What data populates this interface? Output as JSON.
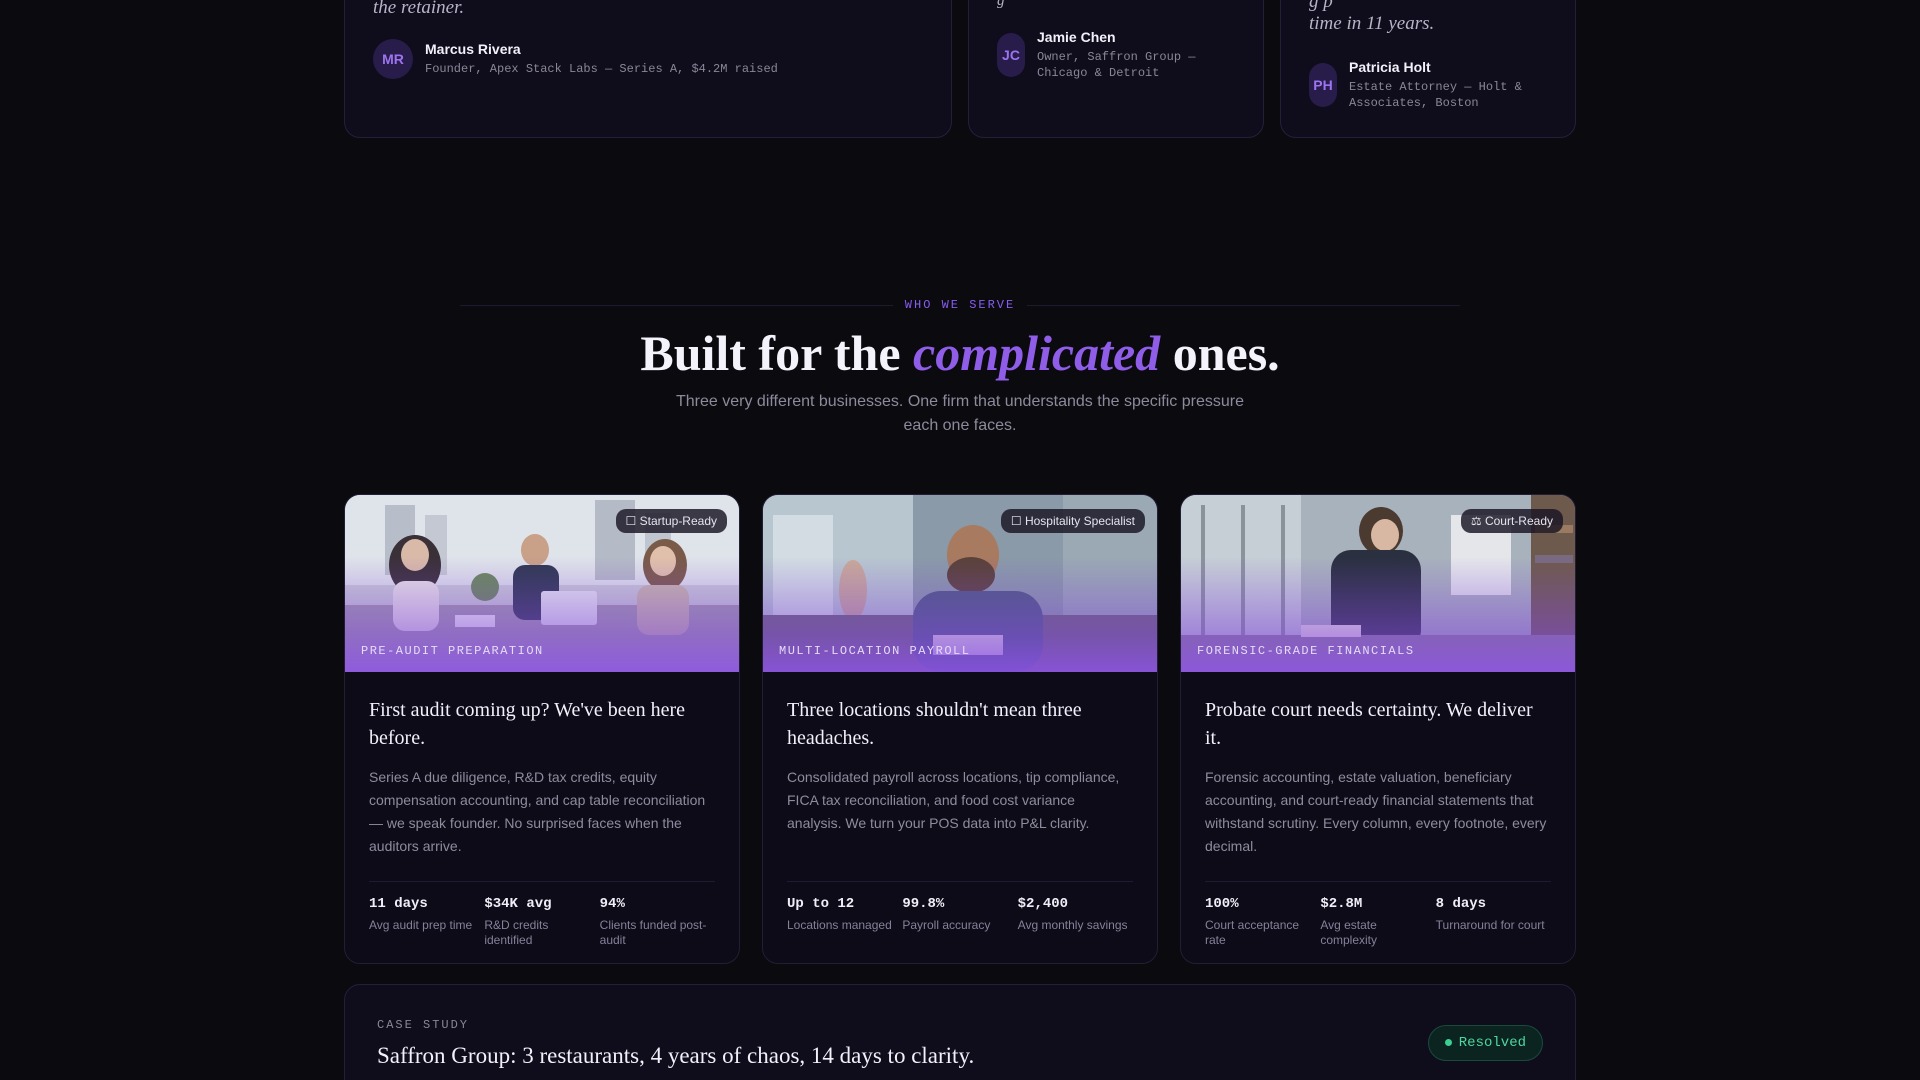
{
  "testimonials": [
    {
      "quote": "the retainer.",
      "initials": "MR",
      "name": "Marcus Rivera",
      "role": "Founder, Apex Stack Labs — Series A, $4.2M raised"
    },
    {
      "quote": "g",
      "initials": "JC",
      "name": "Jamie Chen",
      "role_line1": "Owner, Saffron Group —",
      "role_line2": "Chicago & Detroit"
    },
    {
      "quote_line1": "g  p",
      "quote_line2": "time in 11 years.",
      "initials": "PH",
      "name": "Patricia Holt",
      "role_line1": "Estate Attorney — Holt &",
      "role_line2": "Associates, Boston"
    }
  ],
  "section": {
    "eyebrow": "WHO WE SERVE",
    "headline_pre": "Built for the ",
    "headline_accent": "complicated",
    "headline_post": " ones.",
    "subhead": "Three very different businesses. One firm that understands the specific pressure each one faces."
  },
  "cards": [
    {
      "badge": "☐ Startup-Ready",
      "image_label": "PRE-AUDIT PREPARATION",
      "title": "First audit coming up? We've been here before.",
      "desc": "Series A due diligence, R&D tax credits, equity compensation accounting, and cap table reconciliation — we speak founder. No surprised faces when the auditors arrive.",
      "stats": [
        {
          "value": "11 days",
          "label": "Avg audit prep time"
        },
        {
          "value": "$34K avg",
          "label": "R&D credits identified"
        },
        {
          "value": "94%",
          "label": "Clients funded post-audit"
        }
      ]
    },
    {
      "badge": "☐ Hospitality Specialist",
      "image_label": "MULTI-LOCATION PAYROLL",
      "title": "Three locations shouldn't mean three headaches.",
      "desc": "Consolidated payroll across locations, tip compliance, FICA tax reconciliation, and food cost variance analysis. We turn your POS data into P&L clarity.",
      "stats": [
        {
          "value": "Up to 12",
          "label": "Locations managed"
        },
        {
          "value": "99.8%",
          "label": "Payroll accuracy"
        },
        {
          "value": "$2,400",
          "label": "Avg monthly savings"
        }
      ]
    },
    {
      "badge": "⚖ Court-Ready",
      "image_label": "FORENSIC-GRADE FINANCIALS",
      "title": "Probate court needs certainty. We deliver it.",
      "desc": "Forensic accounting, estate valuation, beneficiary accounting, and court-ready financial statements that withstand scrutiny. Every column, every footnote, every decimal.",
      "stats": [
        {
          "value": "100%",
          "label": "Court acceptance rate"
        },
        {
          "value": "$2.8M",
          "label": "Avg estate complexity"
        },
        {
          "value": "8 days",
          "label": "Turnaround for court"
        }
      ]
    }
  ],
  "case_study": {
    "eyebrow": "CASE STUDY",
    "title": "Saffron Group: 3 restaurants, 4 years of chaos, 14 days to clarity.",
    "status": "Resolved"
  },
  "colors": {
    "accent": "#8f5de8",
    "background": "#0a0a0f",
    "success": "#4fd6a0"
  }
}
